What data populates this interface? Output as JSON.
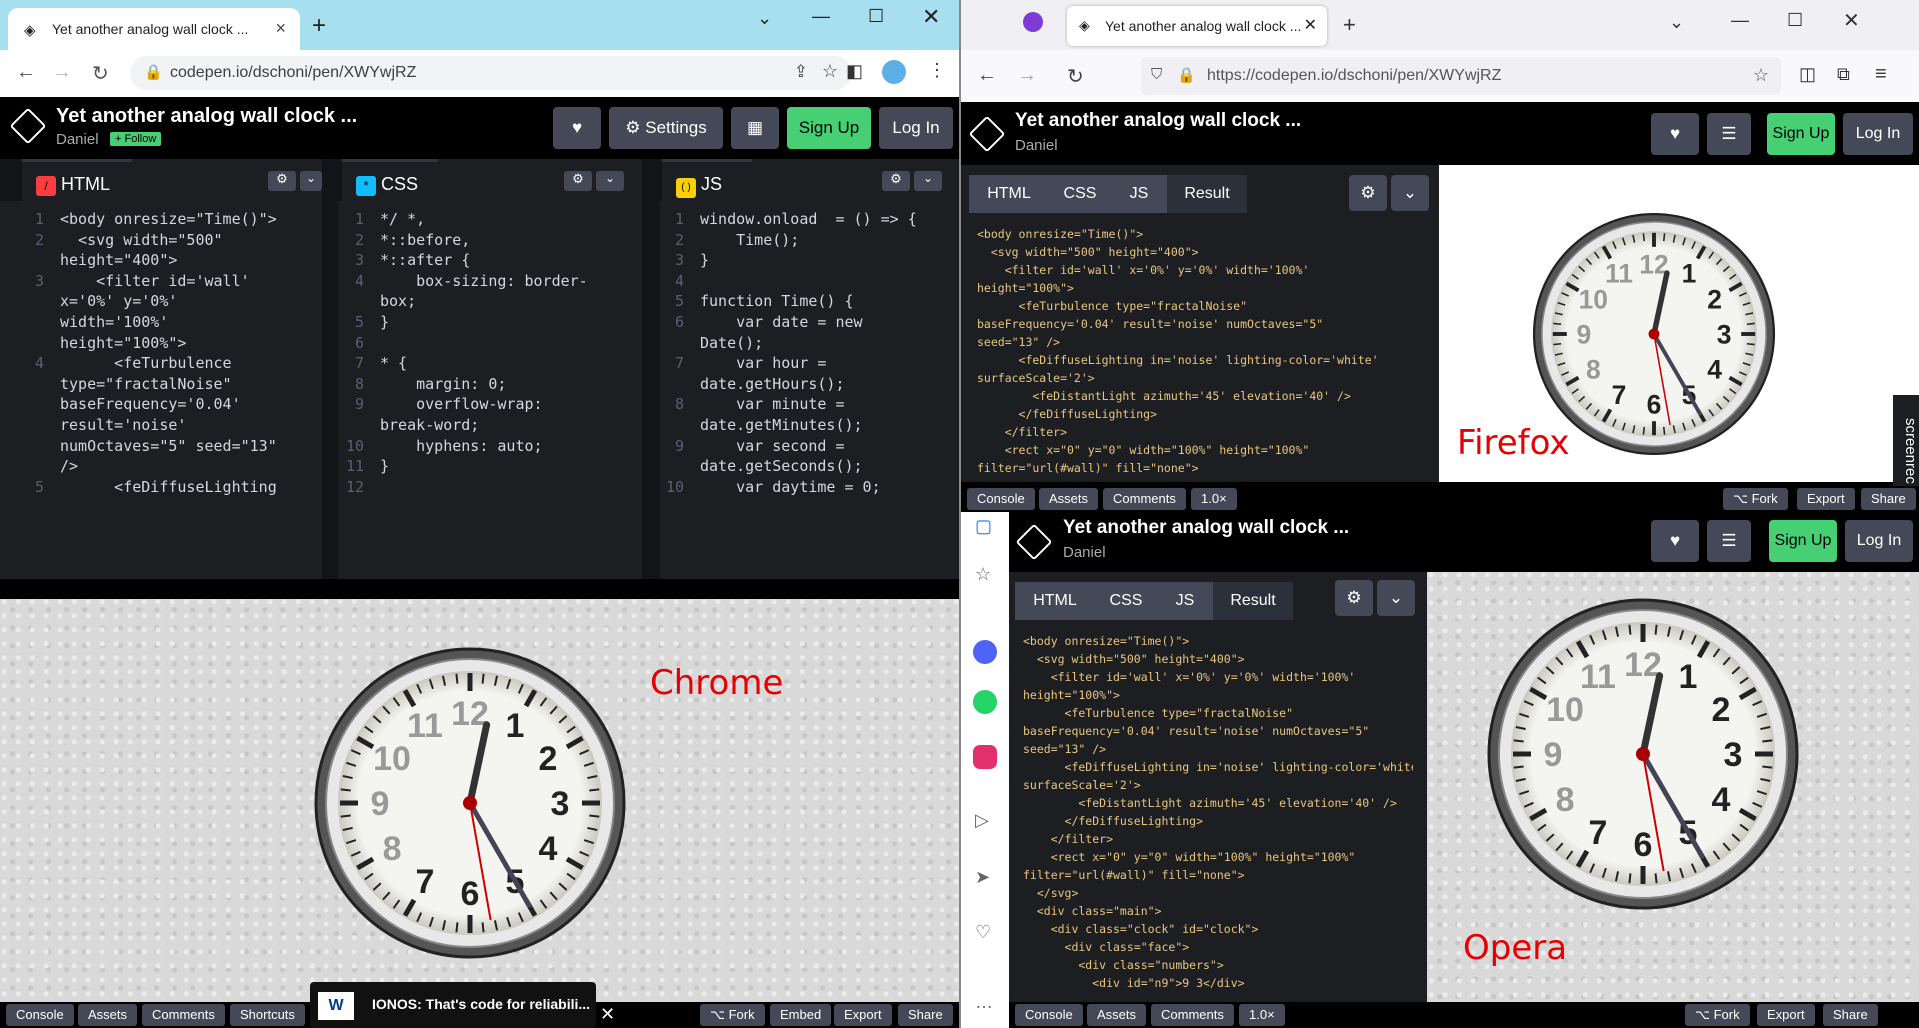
{
  "chrome": {
    "tab_title": "Yet another analog wall clock ...",
    "url": "codepen.io/dschoni/pen/XWYwjRZ",
    "pen_title": "Yet another analog wall clock ...",
    "author": "Daniel",
    "follow_label": "+ Follow",
    "settings_label": "Settings",
    "signup_label": "Sign Up",
    "login_label": "Log In",
    "panes": [
      {
        "name": "HTML",
        "badge": "/",
        "badge_color": "#ff3c41"
      },
      {
        "name": "CSS",
        "badge": "*",
        "badge_color": "#0ebeff"
      },
      {
        "name": "JS",
        "badge": "( )",
        "badge_color": "#fcd000"
      }
    ],
    "html_code": [
      {
        "n": "1",
        "t": "<body onresize=\"Time()\">"
      },
      {
        "n": "2",
        "t": "  <svg width=\"500\""
      },
      {
        "n": "",
        "t": "height=\"400\">"
      },
      {
        "n": "3",
        "t": "    <filter id='wall'"
      },
      {
        "n": "",
        "t": "x='0%' y='0%'"
      },
      {
        "n": "",
        "t": "width='100%'"
      },
      {
        "n": "",
        "t": "height=\"100%\">"
      },
      {
        "n": "4",
        "t": "      <feTurbulence"
      },
      {
        "n": "",
        "t": "type=\"fractalNoise\""
      },
      {
        "n": "",
        "t": "baseFrequency='0.04'"
      },
      {
        "n": "",
        "t": "result='noise'"
      },
      {
        "n": "",
        "t": "numOctaves=\"5\" seed=\"13\""
      },
      {
        "n": "",
        "t": "/>"
      },
      {
        "n": "5",
        "t": "      <feDiffuseLighting"
      }
    ],
    "css_code": [
      {
        "n": "1",
        "t": "*/ *,"
      },
      {
        "n": "2",
        "t": "*::before,"
      },
      {
        "n": "3",
        "t": "*::after {"
      },
      {
        "n": "4",
        "t": "    box-sizing: border-"
      },
      {
        "n": "",
        "t": "box;"
      },
      {
        "n": "5",
        "t": "}"
      },
      {
        "n": "6",
        "t": ""
      },
      {
        "n": "7",
        "t": "* {"
      },
      {
        "n": "8",
        "t": "    margin: 0;"
      },
      {
        "n": "9",
        "t": "    overflow-wrap:"
      },
      {
        "n": "",
        "t": "break-word;"
      },
      {
        "n": "10",
        "t": "    hyphens: auto;"
      },
      {
        "n": "11",
        "t": "}"
      },
      {
        "n": "12",
        "t": ""
      }
    ],
    "js_code": [
      {
        "n": "1",
        "t": "window.onload  = () => {"
      },
      {
        "n": "2",
        "t": "    Time();"
      },
      {
        "n": "3",
        "t": "}"
      },
      {
        "n": "4",
        "t": ""
      },
      {
        "n": "5",
        "t": "function Time() {"
      },
      {
        "n": "6",
        "t": "    var date = new"
      },
      {
        "n": "",
        "t": "Date();"
      },
      {
        "n": "7",
        "t": "    var hour ="
      },
      {
        "n": "",
        "t": "date.getHours();"
      },
      {
        "n": "8",
        "t": "    var minute ="
      },
      {
        "n": "",
        "t": "date.getMinutes();"
      },
      {
        "n": "9",
        "t": "    var second ="
      },
      {
        "n": "",
        "t": "date.getSeconds();"
      },
      {
        "n": "10",
        "t": "    var daytime = 0;"
      }
    ],
    "browser_label": "Chrome",
    "footer": [
      "Console",
      "Assets",
      "Comments",
      "Shortcuts"
    ],
    "footer_right": [
      "Fork",
      "Embed",
      "Export",
      "Share"
    ],
    "ad_text": "IONOS: That's code for reliabili..."
  },
  "firefox": {
    "tab_title": "Yet another analog wall clock ...",
    "url": "https://codepen.io/dschoni/pen/XWYwjRZ",
    "pen_title": "Yet another analog wall clock ...",
    "author": "Daniel",
    "signup_label": "Sign Up",
    "login_label": "Log In",
    "tabs": [
      "HTML",
      "CSS",
      "JS",
      "Result"
    ],
    "browser_label": "Firefox",
    "footer": [
      "Console",
      "Assets",
      "Comments",
      "1.0×"
    ],
    "footer_right": [
      "Fork",
      "Export",
      "Share"
    ]
  },
  "opera": {
    "pen_title": "Yet another analog wall clock ...",
    "author": "Daniel",
    "signup_label": "Sign Up",
    "login_label": "Log In",
    "tabs": [
      "HTML",
      "CSS",
      "JS",
      "Result"
    ],
    "browser_label": "Opera",
    "footer": [
      "Console",
      "Assets",
      "Comments",
      "1.0×"
    ],
    "footer_right": [
      "Fork",
      "Export",
      "Share"
    ]
  },
  "ff_code": [
    "<body onresize=\"Time()\">",
    "  <svg width=\"500\" height=\"400\">",
    "    <filter id='wall' x='0%' y='0%' width='100%'",
    "height=\"100%\">",
    "      <feTurbulence type=\"fractalNoise\"",
    "baseFrequency='0.04' result='noise' numOctaves=\"5\"",
    "seed=\"13\" />",
    "      <feDiffuseLighting in='noise' lighting-color='white'",
    "surfaceScale='2'>",
    "        <feDistantLight azimuth='45' elevation='40' />",
    "      </feDiffuseLighting>",
    "    </filter>",
    "    <rect x=\"0\" y=\"0\" width=\"100%\" height=\"100%\"",
    "filter=\"url(#wall)\" fill=\"none\">"
  ],
  "op_code": [
    "<body onresize=\"Time()\">",
    "  <svg width=\"500\" height=\"400\">",
    "    <filter id='wall' x='0%' y='0%' width='100%'",
    "height=\"100%\">",
    "      <feTurbulence type=\"fractalNoise\"",
    "baseFrequency='0.04' result='noise' numOctaves=\"5\"",
    "seed=\"13\" />",
    "      <feDiffuseLighting in='noise' lighting-color='white'",
    "surfaceScale='2'>",
    "        <feDistantLight azimuth='45' elevation='40' />",
    "      </feDiffuseLighting>",
    "    </filter>",
    "    <rect x=\"0\" y=\"0\" width=\"100%\" height=\"100%\"",
    "filter=\"url(#wall)\" fill=\"none\">",
    "  </svg>",
    "  <div class=\"main\">",
    "    <div class=\"clock\" id=\"clock\">",
    "      <div class=\"face\">",
    "        <div class=\"numbers\">",
    "          <div id=\"n9\">9 3</div>"
  ],
  "clock_numbers": [
    "12",
    "1",
    "2",
    "3",
    "4",
    "5",
    "6",
    "7",
    "8",
    "9",
    "10",
    "11"
  ],
  "screenrec_label": "screenrec"
}
